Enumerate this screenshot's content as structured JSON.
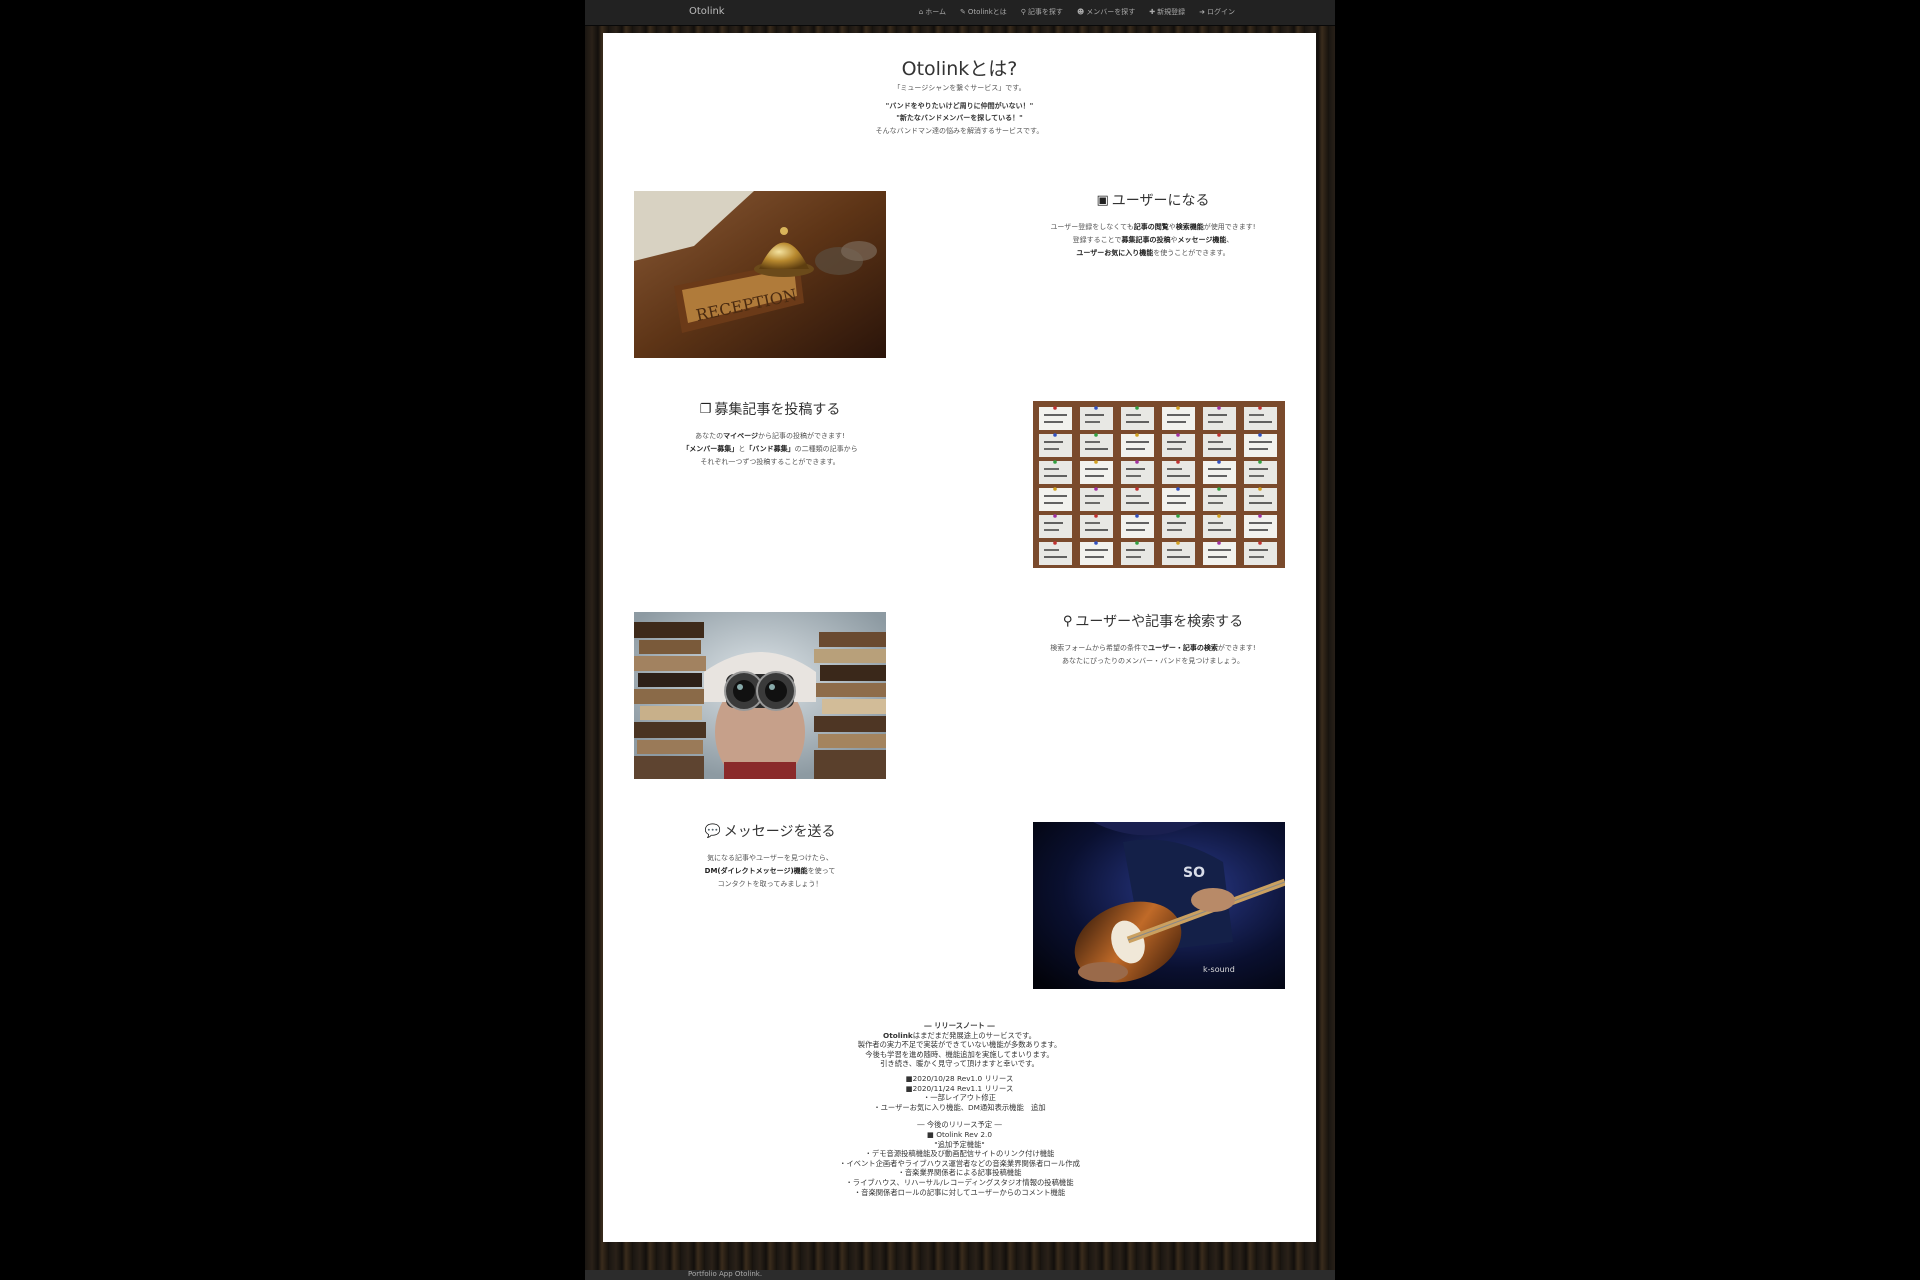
{
  "navbar": {
    "brand": "Otolink",
    "links": [
      {
        "icon": "home-icon",
        "glyph": "⌂",
        "label": "ホーム"
      },
      {
        "icon": "edit-icon",
        "glyph": "✎",
        "label": "Otolinkとは"
      },
      {
        "icon": "search-icon",
        "glyph": "⚲",
        "label": "記事を探す"
      },
      {
        "icon": "users-icon",
        "glyph": "☻",
        "label": "メンバーを探す"
      },
      {
        "icon": "user-plus-icon",
        "glyph": "✚",
        "label": "新規登録"
      },
      {
        "icon": "sign-in-icon",
        "glyph": "➜",
        "label": "ログイン"
      }
    ]
  },
  "hero": {
    "title": "Otolinkとは?",
    "tagline": "「ミュージシャンを繋ぐサービス」です。",
    "quote1": "\"バンドをやりたいけど周りに仲間がいない！\"",
    "quote2": "\"新たなバンドメンバーを探している！\"",
    "desc": "そんなバンドマン達の悩みを解消するサービスです。"
  },
  "features": {
    "user": {
      "icon": "id-card-icon",
      "glyph": "▣",
      "title": "ユーザーになる",
      "line1_a": "ユーザー登録をしなくても",
      "line1_b": "記事の閲覧",
      "line1_c": "や",
      "line1_d": "検索機能",
      "line1_e": "が使用できます!",
      "line2_a": "登録することで",
      "line2_b": "募集記事の投稿",
      "line2_c": "や",
      "line2_d": "メッセージ機能",
      "line2_e": "、",
      "line3_b": "ユーザーお気に入り機能",
      "line3_c": "を使うことができます。",
      "image_alt": "reception-bell-photo"
    },
    "post": {
      "icon": "copy-icon",
      "glyph": "❐",
      "title": "募集記事を投稿する",
      "line1_a": "あなたの",
      "line1_b": "マイページ",
      "line1_c": "から記事の投稿ができます!",
      "line2_b": "「メンバー募集」",
      "line2_c": "と",
      "line2_d": "「バンド募集」",
      "line2_e": "の二種類の記事から",
      "line3": "それぞれ一つずつ投稿することができます。",
      "image_alt": "sticky-notes-photo"
    },
    "search": {
      "icon": "search-icon",
      "glyph": "⚲",
      "title": "ユーザーや記事を検索する",
      "line1_a": "検索フォームから希望の条件で",
      "line1_b": "ユーザー・記事の検索",
      "line1_c": "ができます!",
      "line2": "あなたにぴったりのメンバー・バンドを見つけましょう。",
      "image_alt": "binoculars-photo"
    },
    "message": {
      "icon": "comments-icon",
      "glyph": "💬",
      "title": "メッセージを送る",
      "line1": "気になる記事やユーザーを見つけたら、",
      "line2_b": "DM(ダイレクトメッセージ)機能",
      "line2_c": "を使って",
      "line3": "コンタクトを取ってみましょう！",
      "image_alt": "bass-guitar-photo"
    }
  },
  "release_notes": {
    "heading": "― リリースノート ―",
    "intro1_b": "Otolink",
    "intro1_c": "はまだまだ発展途上のサービスです。",
    "intro2": "製作者の実力不足で実装ができていない機能が多数あります。",
    "intro3": "今後も学習を進め随時、機能追加を実施してまいります。",
    "intro4": "引き続き、暖かく見守って頂けますと幸いです。",
    "r1": "■2020/10/28 Rev1.0 リリース",
    "r2": "■2020/11/24 Rev1.1 リリース",
    "r2a": "・一部レイアウト修正",
    "r2b": "・ユーザーお気に入り機能、DM通知表示機能　追加",
    "plan_heading": "― 今後のリリース予定 ―",
    "plan1": "■ Otolink Rev 2.0",
    "plan2": "\"追加予定機能\"",
    "plan3": "・デモ音源投稿機能及び動画配信サイトのリンク付け機能",
    "plan4": "・イベント企画者やライブハウス運営者などの音楽業界関係者ロール作成",
    "plan5": "・音楽業界関係者による記事投稿機能",
    "plan6": "・ライブハウス、リハーサル/レコーディングスタジオ情報の投稿機能",
    "plan7": "・音楽関係者ロールの記事に対してユーザーからのコメント機能"
  },
  "footer": {
    "text": "Portfolio App Otolink."
  }
}
